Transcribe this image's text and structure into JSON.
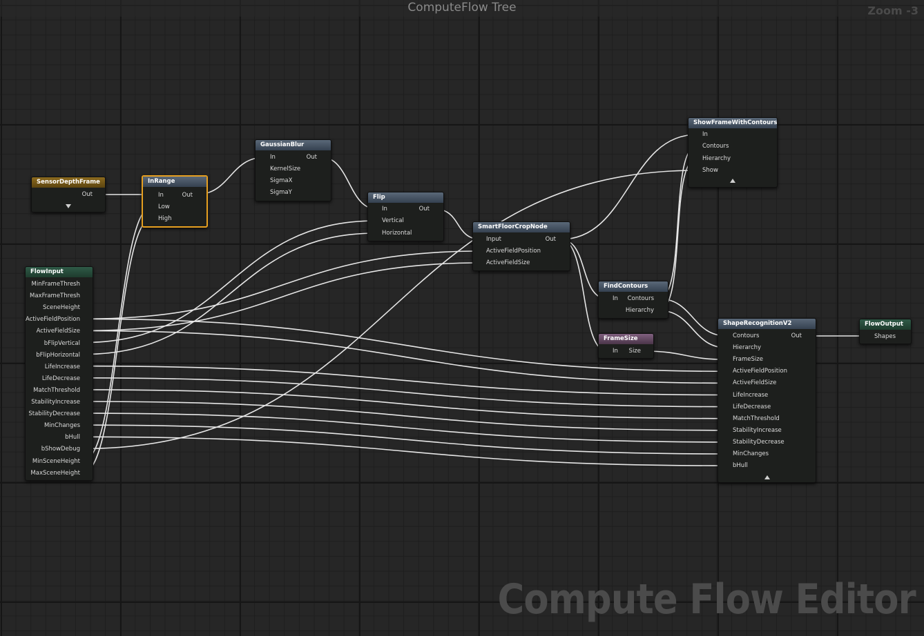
{
  "graph": {
    "title": "ComputeFlow Tree",
    "zoom_label": "Zoom -3",
    "watermark": "Compute Flow Editor"
  },
  "colors": {
    "exec": "#ffffff",
    "float": "#2be0a6",
    "vector": "#e6c494",
    "bool": "#a80d0d",
    "int": "#7be02b",
    "selected": "#e7a020"
  },
  "nodes": {
    "sensor": {
      "title": "SensorDepthFrame",
      "out": "Out"
    },
    "inrange": {
      "title": "InRange",
      "in": "In",
      "low": "Low",
      "high": "High",
      "out": "Out"
    },
    "blur": {
      "title": "GaussianBlur",
      "in": "In",
      "kernel": "KernelSize",
      "sigmax": "SigmaX",
      "sigmay": "SigmaY",
      "out": "Out"
    },
    "flip": {
      "title": "Flip",
      "in": "In",
      "vertical": "Vertical",
      "horizontal": "Horizontal",
      "out": "Out"
    },
    "crop": {
      "title": "SmartFloorCropNode",
      "input": "Input",
      "pos": "ActiveFieldPosition",
      "size": "ActiveFieldSize",
      "out": "Out"
    },
    "show": {
      "title": "ShowFrameWithContours",
      "in": "In",
      "contours": "Contours",
      "hierarchy": "Hierarchy",
      "show": "Show"
    },
    "find": {
      "title": "FindContours",
      "in": "In",
      "contours": "Contours",
      "hierarchy": "Hierarchy"
    },
    "framesize": {
      "title": "FrameSize",
      "in": "In",
      "size": "Size"
    },
    "shape": {
      "title": "ShapeRecognitionV2",
      "out": "Out",
      "inputs": [
        "Contours",
        "Hierarchy",
        "FrameSize",
        "ActiveFieldPosition",
        "ActiveFieldSize",
        "LifeIncrease",
        "LifeDecrease",
        "MatchThreshold",
        "StabilityIncrease",
        "StabilityDecrease",
        "MinChanges",
        "bHull"
      ]
    },
    "output": {
      "title": "FlowOutput",
      "shapes": "Shapes"
    },
    "flowinput": {
      "title": "FlowInput",
      "outputs": [
        "MinFrameThresh",
        "MaxFrameThresh",
        "SceneHeight",
        "ActiveFieldPosition",
        "ActiveFieldSize",
        "bFlipVertical",
        "bFlipHorizontal",
        "LifeIncrease",
        "LifeDecrease",
        "MatchThreshold",
        "StabilityIncrease",
        "StabilityDecrease",
        "MinChanges",
        "bHull",
        "bShowDebug",
        "MinSceneHeight",
        "MaxSceneHeight"
      ]
    }
  }
}
